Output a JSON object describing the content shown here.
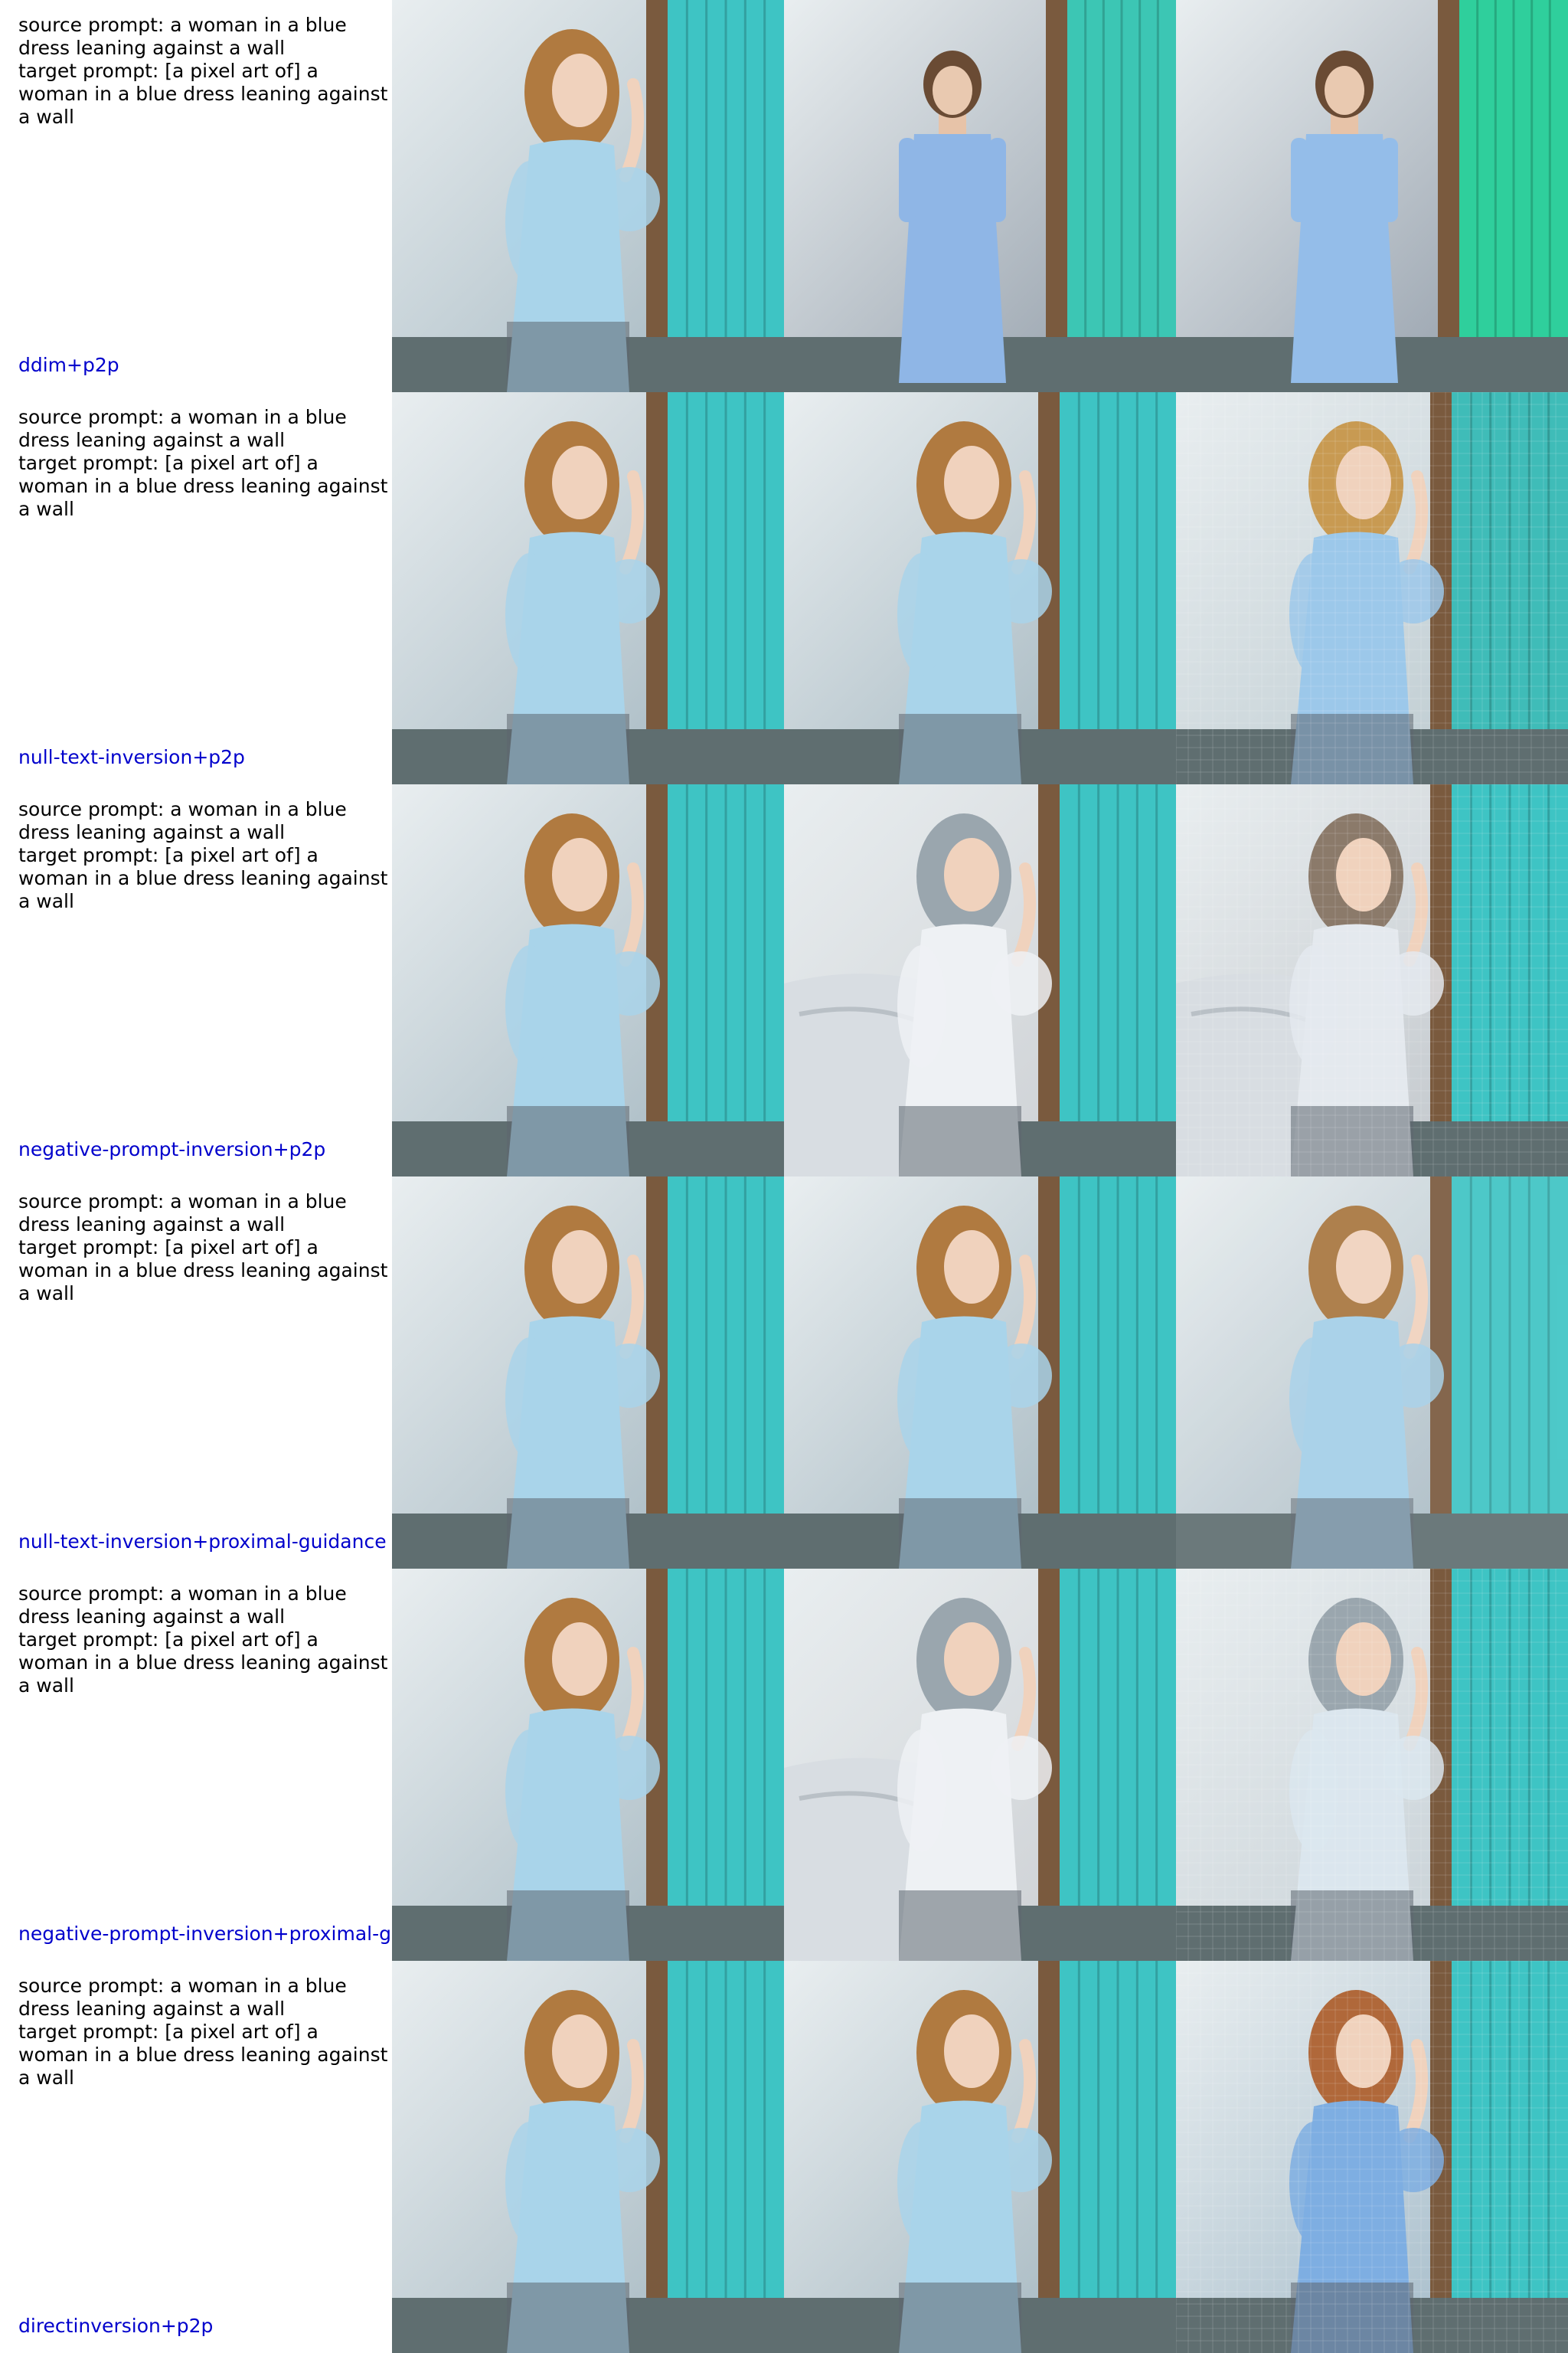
{
  "rows": [
    {
      "prompt": "source prompt: a woman in a blue\ndress leaning against a wall\ntarget prompt: [a pixel art of] a\nwoman in a blue dress leaning against\na wall",
      "method": "ddim+p2p",
      "images": [
        {
          "variant": "source",
          "wall": "#9fb3bd",
          "door": "#3ec4c4",
          "dress": "#a9d4ea",
          "hair": "#b07a40",
          "style": "photo"
        },
        {
          "variant": "standing",
          "wall": "#8f9aa6",
          "door": "#3cc6b4",
          "dress": "#8fb6e6",
          "hair": "#6a4b34",
          "style": "photo"
        },
        {
          "variant": "standing",
          "wall": "#8b96a3",
          "door": "#2fcf9c",
          "dress": "#94bde9",
          "hair": "#6a4b34",
          "style": "photo"
        }
      ]
    },
    {
      "prompt": "source prompt: a woman in a blue\ndress leaning against a wall\ntarget prompt: [a pixel art of] a\nwoman in a blue dress leaning against\na wall",
      "method": "null-text-inversion+p2p",
      "images": [
        {
          "variant": "source",
          "wall": "#9fb3bd",
          "door": "#3ec4c4",
          "dress": "#a9d4ea",
          "hair": "#b07a40",
          "style": "photo"
        },
        {
          "variant": "source",
          "wall": "#9cb0ba",
          "door": "#3ec4c4",
          "dress": "#a9d4ea",
          "hair": "#b07a40",
          "style": "photo"
        },
        {
          "variant": "wavy",
          "wall": "#b7c6cc",
          "door": "#3fbcb8",
          "dress": "#9cc8ea",
          "hair": "#c89a52",
          "style": "pixel"
        }
      ]
    },
    {
      "prompt": "source prompt: a woman in a blue\ndress leaning against a wall\ntarget prompt: [a pixel art of] a\nwoman in a blue dress leaning against\na wall",
      "method": "negative-prompt-inversion+p2p",
      "images": [
        {
          "variant": "source",
          "wall": "#9fb3bd",
          "door": "#3ec4c4",
          "dress": "#a9d4ea",
          "hair": "#b07a40",
          "style": "photo"
        },
        {
          "variant": "bed",
          "wall": "#c9ccd0",
          "door": "#3ec4c4",
          "dress": "#eef1f4",
          "hair": "#9aa6ae",
          "style": "photo"
        },
        {
          "variant": "bed",
          "wall": "#bcc1c6",
          "door": "#3ec4c4",
          "dress": "#e4e9ee",
          "hair": "#8b7a6a",
          "style": "pixel"
        }
      ]
    },
    {
      "prompt": "source prompt: a woman in a blue\ndress leaning against a wall\ntarget prompt: [a pixel art of] a\nwoman in a blue dress leaning against\na wall",
      "method": "null-text-inversion+proximal-guidance",
      "images": [
        {
          "variant": "source",
          "wall": "#9fb3bd",
          "door": "#3ec4c4",
          "dress": "#a9d4ea",
          "hair": "#b07a40",
          "style": "photo"
        },
        {
          "variant": "source",
          "wall": "#9cb0ba",
          "door": "#3ec4c4",
          "dress": "#a9d4ea",
          "hair": "#b07a40",
          "style": "photo"
        },
        {
          "variant": "source",
          "wall": "#9aaeb9",
          "door": "#3ec4c4",
          "dress": "#a3cfe8",
          "hair": "#a8763e",
          "style": "soft"
        }
      ]
    },
    {
      "prompt": "source prompt: a woman in a blue\ndress leaning against a wall\ntarget prompt: [a pixel art of] a\nwoman in a blue dress leaning against\na wall",
      "method": "negative-prompt-inversion+proximal-guidance",
      "images": [
        {
          "variant": "source",
          "wall": "#9fb3bd",
          "door": "#3ec4c4",
          "dress": "#a9d4ea",
          "hair": "#b07a40",
          "style": "photo"
        },
        {
          "variant": "bed",
          "wall": "#c9ccd0",
          "door": "#3ec4c4",
          "dress": "#eef1f4",
          "hair": "#9aa6ae",
          "style": "photo"
        },
        {
          "variant": "source",
          "wall": "#c2ccd2",
          "door": "#3ec4c4",
          "dress": "#dbe6ee",
          "hair": "#9aa6ae",
          "style": "pixel"
        }
      ]
    },
    {
      "prompt": "source prompt: a woman in a blue\ndress leaning against a wall\ntarget prompt: [a pixel art of] a\nwoman in a blue dress leaning against\na wall",
      "method": "directinversion+p2p",
      "images": [
        {
          "variant": "source",
          "wall": "#9fb3bd",
          "door": "#3ec4c4",
          "dress": "#a9d4ea",
          "hair": "#b07a40",
          "style": "photo"
        },
        {
          "variant": "source",
          "wall": "#9cb0ba",
          "door": "#3ec4c4",
          "dress": "#a9d4ea",
          "hair": "#b07a40",
          "style": "photo"
        },
        {
          "variant": "source",
          "wall": "#9ab4c4",
          "door": "#3ec4c4",
          "dress": "#7eaee2",
          "hair": "#b0683a",
          "style": "pixel"
        }
      ]
    }
  ]
}
